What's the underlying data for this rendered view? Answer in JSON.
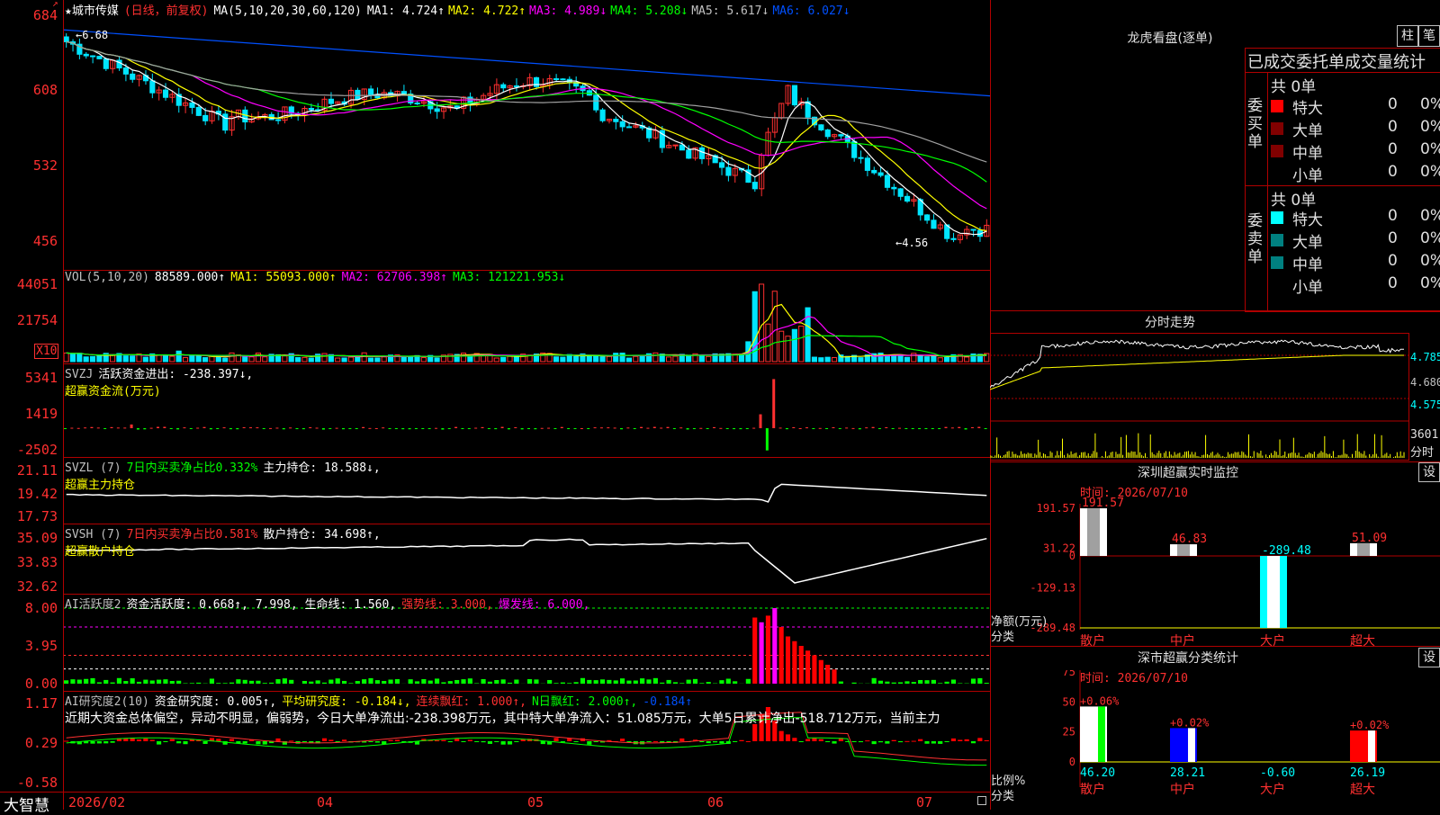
{
  "colors": {
    "up": "#ff3030",
    "down": "#00e5ff",
    "ma1": "#ffffff",
    "ma2": "#ffff00",
    "ma3": "#ff00ff",
    "ma4": "#00ff00",
    "ma5": "#a0a0a0",
    "ma6": "#0050ff",
    "grid": "#b00000"
  },
  "main": {
    "stock_name": "★城市传媒",
    "period": "(日线，前复权)",
    "ma_title": "MA(5,10,20,30,60,120)",
    "ma": [
      {
        "label": "MA1:",
        "value": "4.724↑",
        "color": "#ffffff"
      },
      {
        "label": "MA2:",
        "value": "4.722↑",
        "color": "#ffff00"
      },
      {
        "label": "MA3:",
        "value": "4.989↓",
        "color": "#ff00ff"
      },
      {
        "label": "MA4:",
        "value": "5.208↓",
        "color": "#00ff00"
      },
      {
        "label": "MA5:",
        "value": "5.617↓",
        "color": "#c0c0c0"
      },
      {
        "label": "MA6:",
        "value": "6.027↓",
        "color": "#0050ff"
      }
    ],
    "y_labels": [
      "684",
      "608",
      "532",
      "456"
    ],
    "high_marker": "6.68",
    "low_marker": "4.56"
  },
  "vol": {
    "title": "VOL(5,10,20)",
    "value": "88589.000↑",
    "ma1": "MA1: 55093.000↑",
    "ma2": "MA2: 62706.398↑",
    "ma3": "MA3: 121221.953↓",
    "y_labels": [
      "44051",
      "21754"
    ],
    "unit": "X10"
  },
  "svzj": {
    "title": "SVZJ",
    "label": "活跃资金进出: -238.397↓,",
    "sub": "超赢资金流(万元)",
    "y_labels": [
      "5341",
      "1419",
      "-2502"
    ]
  },
  "svzl": {
    "title": "SVZL (7)",
    "label_red": "7日内买卖净占比0.332%",
    "label": "主力持仓: 18.588↓,",
    "sub": "超赢主力持仓",
    "y_labels": [
      "21.11",
      "19.42",
      "17.73"
    ]
  },
  "svsh": {
    "title": "SVSH (7)",
    "label_red": "7日内买卖净占比0.581%",
    "label": "散户持仓: 34.698↑,",
    "sub": "超赢散户持仓",
    "y_labels": [
      "35.09",
      "33.83",
      "32.62"
    ]
  },
  "aihy": {
    "title": "AI活跃度2",
    "label": "资金活跃度: 0.668↑, 7.998, 生命线: 1.560,",
    "strong": "强势线: 3.000,",
    "burst": "爆发线: 6.000,",
    "y_labels": [
      "8.00",
      "3.95",
      "0.00"
    ]
  },
  "aiyj": {
    "title": "AI研究度2(10)",
    "label": "资金研究度: 0.005↑,",
    "avg": "平均研究度: -0.184↓,",
    "lian": "连续飘红: 1.000↑,",
    "nday": "N日飘红: 2.000↑,",
    "last": "-0.184↑",
    "comment": "近期大资金总体偏空，异动不明显，偏弱势，今日大单净流出:-238.398万元，其中特大单净流入：51.085万元，大单5日累计净出-518.712万元，当前主力",
    "y_labels": [
      "1.17",
      "0.29",
      "-0.58"
    ]
  },
  "xaxis": {
    "brand": "大智慧",
    "labels": [
      "2026/02",
      "04",
      "05",
      "06",
      "07"
    ]
  },
  "right": {
    "dragon_title": "龙虎看盘(逐单)",
    "btn_zhu": "柱",
    "btn_bi": "笔",
    "tabs": "已成交委托单成交量统计",
    "buy": {
      "side": "委买单",
      "total": "共 0单",
      "rows": [
        {
          "name": "特大",
          "count": "0",
          "pct": "0%",
          "color": "#ff0000"
        },
        {
          "name": "大单",
          "count": "0",
          "pct": "0%",
          "color": "#800000"
        },
        {
          "name": "中单",
          "count": "0",
          "pct": "0%",
          "color": "#800000"
        },
        {
          "name": "小单",
          "count": "0",
          "pct": "0%",
          "color": ""
        }
      ]
    },
    "sell": {
      "side": "委卖单",
      "total": "共 0单",
      "rows": [
        {
          "name": "特大",
          "count": "0",
          "pct": "0%",
          "color": "#00ffff"
        },
        {
          "name": "大单",
          "count": "0",
          "pct": "0%",
          "color": "#008080"
        },
        {
          "name": "中单",
          "count": "0",
          "pct": "0%",
          "color": "#008080"
        },
        {
          "name": "小单",
          "count": "0",
          "pct": "0%",
          "color": ""
        }
      ]
    },
    "intraday": {
      "title": "分时走势",
      "y_labels": [
        "4.785",
        "4.680",
        "4.575"
      ],
      "vol_label": "3601",
      "vol_unit": "分时"
    },
    "monitor": {
      "title": "深圳超赢实时监控",
      "btn": "设",
      "time": "时间: 2026/07/10",
      "y_labels": [
        "191.57",
        "31.22",
        "0",
        "-129.13",
        "-289.48"
      ],
      "ylab": "净额(万元)",
      "xlab": "分类",
      "bars": [
        {
          "cat": "散户",
          "value": 191.57,
          "label": "191.57"
        },
        {
          "cat": "中户",
          "value": 46.83,
          "label": "46.83"
        },
        {
          "cat": "大户",
          "value": -289.48,
          "label": "-289.48"
        },
        {
          "cat": "超大",
          "value": 51.09,
          "label": "51.09"
        }
      ]
    },
    "classify": {
      "title": "深市超赢分类统计",
      "btn": "设",
      "time": "时间: 2026/07/10",
      "y_labels": [
        "75",
        "50",
        "25",
        "0"
      ],
      "ylab": "比例%",
      "xlab": "分类",
      "bars": [
        {
          "cat": "散户",
          "value": 46.2,
          "label": "46.20",
          "top": "+0.06%",
          "color": "#ffffff",
          "accent": "#00ff00"
        },
        {
          "cat": "中户",
          "value": 28.21,
          "label": "28.21",
          "top": "+0.02%",
          "color": "#0000ff",
          "accent": "#ffffff"
        },
        {
          "cat": "大户",
          "value": -0.6,
          "label": "-0.60",
          "top": "",
          "color": "#00ffff",
          "accent": "#00ffff"
        },
        {
          "cat": "超大",
          "value": 26.19,
          "label": "26.19",
          "top": "+0.02%",
          "color": "#ff0000",
          "accent": "#ffffff"
        }
      ]
    }
  }
}
